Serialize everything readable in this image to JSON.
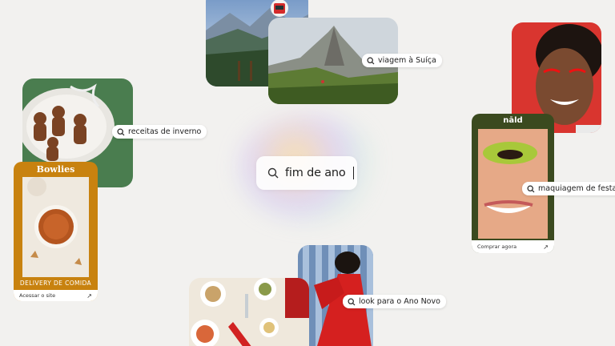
{
  "main_search": {
    "query": "fim de ano"
  },
  "pills": {
    "switzerland": "viagem à Suíça",
    "winter_recipes": "receitas de inverno",
    "party_makeup": "maquiagem de festa",
    "new_year_look": "look para o Ano Novo"
  },
  "bowlies": {
    "brand": "Bowlies",
    "tagline": "DELIVERY DE COMIDA",
    "cta": "Acessar o site"
  },
  "nald": {
    "brand": "nāld",
    "cta": "Comprar agora"
  },
  "colors": {
    "background": "#f2f1ef",
    "bowlies_orange": "#c8820f",
    "nald_green": "#3b4a1f",
    "makeup_red": "#d9352f"
  },
  "icons": [
    "search-icon",
    "arrow-up-right-icon"
  ]
}
